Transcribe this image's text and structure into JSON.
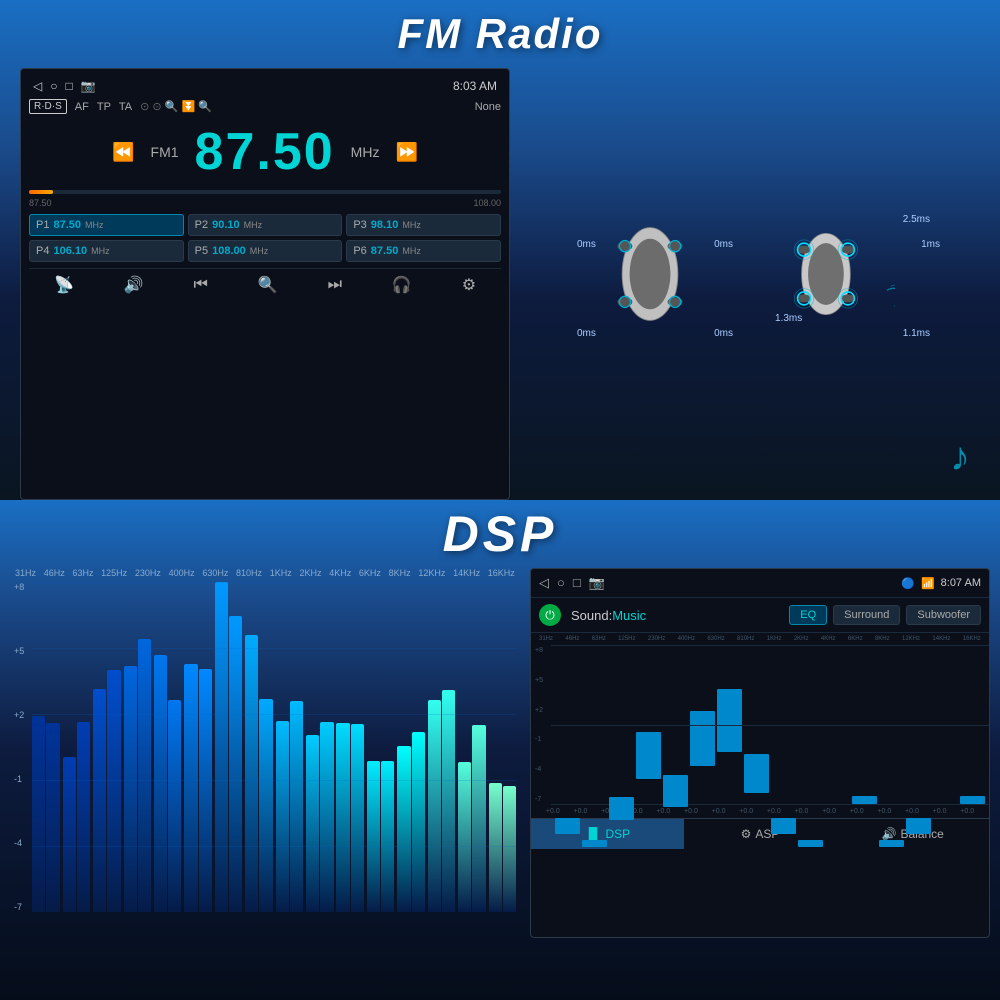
{
  "fm_radio": {
    "title": "FM Radio",
    "screen": {
      "time": "8:03 AM",
      "rds": "R·D·S",
      "options": [
        "AF",
        "TP",
        "TA"
      ],
      "search_label": "None",
      "frequency": "87.50",
      "frequency_label": "FM1",
      "unit": "MHz",
      "range_min": "87.50",
      "range_max": "108.00",
      "presets": [
        {
          "label": "P1",
          "freq": "87.50",
          "unit": "MHz",
          "active": true
        },
        {
          "label": "P2",
          "freq": "90.10",
          "unit": "MHz",
          "active": false
        },
        {
          "label": "P3",
          "freq": "98.10",
          "unit": "MHz",
          "active": false
        },
        {
          "label": "P4",
          "freq": "106.10",
          "unit": "MHz",
          "active": false
        },
        {
          "label": "P5",
          "freq": "108.00",
          "unit": "MHz",
          "active": false
        },
        {
          "label": "P6",
          "freq": "87.50",
          "unit": "MHz",
          "active": false
        }
      ]
    },
    "car_timing": {
      "car1_labels": [
        "0ms",
        "0ms",
        "0ms",
        "0ms"
      ],
      "car2_labels": [
        "2.5ms",
        "1ms",
        "1.3ms",
        "1.1ms"
      ]
    }
  },
  "dsp": {
    "title": "DSP",
    "eq_labels": [
      "31Hz",
      "46Hz",
      "63Hz",
      "125Hz",
      "230Hz",
      "400Hz",
      "630Hz",
      "810Hz",
      "1KHz",
      "2KHz",
      "4KHz",
      "6KHz",
      "8KHz",
      "12KHz",
      "14KHz",
      "16KHz"
    ],
    "db_labels": [
      "+8",
      "+5",
      "+2",
      "-1",
      "-4",
      "-7"
    ],
    "screen": {
      "time": "8:07 AM",
      "sound_label": "Sound:",
      "sound_mode": "Music",
      "tabs": [
        "EQ",
        "Surround",
        "Subwoofer"
      ],
      "active_tab": "EQ",
      "bottom_tabs": [
        "DSP",
        "ASP",
        "Balance"
      ],
      "active_bottom": "DSP"
    },
    "eq_bars_heights": [
      60,
      55,
      65,
      80,
      70,
      85,
      90,
      75,
      60,
      55,
      50,
      45,
      55,
      60,
      50,
      45
    ],
    "colors": {
      "accent": "#00d4d4",
      "bar_low": "#0055aa",
      "bar_high": "#00aaee"
    }
  }
}
